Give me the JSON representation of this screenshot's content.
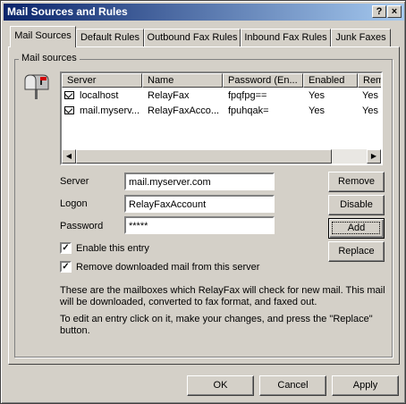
{
  "window": {
    "title": "Mail Sources and Rules",
    "help_button": "?",
    "close_button": "×"
  },
  "tabs": [
    {
      "label": "Mail Sources",
      "active": true
    },
    {
      "label": "Default Rules",
      "active": false
    },
    {
      "label": "Outbound Fax Rules",
      "active": false
    },
    {
      "label": "Inbound Fax Rules",
      "active": false
    },
    {
      "label": "Junk Faxes",
      "active": false
    }
  ],
  "group": {
    "label": "Mail sources",
    "icon": "mailbox-icon"
  },
  "list": {
    "columns": [
      "Server",
      "Name",
      "Password (En...",
      "Enabled",
      "Rem"
    ],
    "rows": [
      {
        "server": "localhost",
        "name": "RelayFax",
        "password": "fpqfpg==",
        "enabled": "Yes",
        "rem": "Yes"
      },
      {
        "server": "mail.myserv...",
        "name": "RelayFaxAcco...",
        "password": "fpuhqak=",
        "enabled": "Yes",
        "rem": "Yes"
      }
    ]
  },
  "form": {
    "server_label": "Server",
    "server_value": "mail.myserver.com",
    "logon_label": "Logon",
    "logon_value": "RelayFaxAccount",
    "password_label": "Password",
    "password_value": "*****"
  },
  "side_buttons": {
    "remove": "Remove",
    "disable": "Disable",
    "add": "Add",
    "replace": "Replace"
  },
  "checkboxes": {
    "enable_label": "Enable this entry",
    "enable_checked": true,
    "remove_label": "Remove downloaded mail from this server",
    "remove_checked": true
  },
  "help_text": {
    "para1": "These are the mailboxes which RelayFax will check for new mail.  This mail will be downloaded, converted to fax format, and faxed out.",
    "para2": "To edit an entry click on it, make your changes, and press the \"Replace\" button."
  },
  "footer": {
    "ok": "OK",
    "cancel": "Cancel",
    "apply": "Apply"
  },
  "colors": {
    "titlebar_start": "#0a246a",
    "titlebar_end": "#a6caf0",
    "face": "#d4d0c8"
  }
}
